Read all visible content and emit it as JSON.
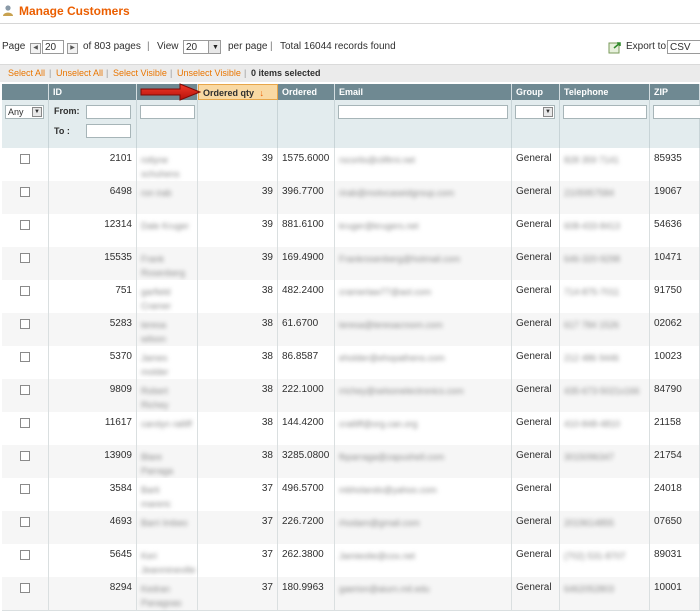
{
  "page": {
    "title": "Manage Customers",
    "accent_color": "#eb5e00"
  },
  "pager": {
    "page_label": "Page",
    "page_value": "20",
    "of_pages": "of 803 pages",
    "sep1": "|",
    "view_label": "View",
    "view_value": "20",
    "per_page": "per page",
    "sep2": "|",
    "total": "Total 16044 records found",
    "export_label": "Export to:",
    "export_value": "CSV"
  },
  "massaction": {
    "select_all": "Select All",
    "unselect_all": "Unselect All",
    "select_visible": "Select Visible",
    "unselect_visible": "Unselect Visible",
    "selected": "0 items selected",
    "sep": "|"
  },
  "columns": {
    "id": "ID",
    "name": "",
    "ordered_qty": "Ordered qty",
    "ordered": "Ordered",
    "email": "Email",
    "group": "Group",
    "telephone": "Telephone",
    "zip": "ZIP"
  },
  "filters": {
    "any": "Any",
    "from": "From:",
    "to": "To :"
  },
  "rows": [
    {
      "id": "2101",
      "name1": "rotlyne",
      "name2": "schuhens",
      "qty": "39",
      "ordered": "1575.6000",
      "email": "rscorlis@cliftrni.net",
      "group": "General",
      "tel": "828 359 7141",
      "zip": "85935"
    },
    {
      "id": "6498",
      "name1": "ron irab",
      "name2": "",
      "qty": "39",
      "ordered": "396.7700",
      "email": "rirab@motvcaseidgroup.com",
      "group": "General",
      "tel": "2105957584",
      "zip": "19067"
    },
    {
      "id": "12314",
      "name1": "Dale Kruger",
      "name2": "",
      "qty": "39",
      "ordered": "881.6100",
      "email": "kruger@krugers.net",
      "group": "General",
      "tel": "608-433-8413",
      "zip": "54636"
    },
    {
      "id": "15535",
      "name1": "Frank",
      "name2": "Rosenberg",
      "qty": "39",
      "ordered": "169.4900",
      "email": "Frankrosenberg@hotmail.com",
      "group": "General",
      "tel": "646-320-9298",
      "zip": "10471"
    },
    {
      "id": "751",
      "name1": "garfield",
      "name2": "Cramer",
      "qty": "38",
      "ordered": "482.2400",
      "email": "cramerlaw77@aol.com",
      "group": "General",
      "tel": "714-875-7011",
      "zip": "91750"
    },
    {
      "id": "5283",
      "name1": "teresa",
      "name2": "wilson",
      "qty": "38",
      "ordered": "61.6700",
      "email": "teresa@teresacroom.com",
      "group": "General",
      "tel": "617 784 1526",
      "zip": "02062"
    },
    {
      "id": "5370",
      "name1": "James",
      "name2": "molder",
      "qty": "38",
      "ordered": "86.8587",
      "email": "eholder@ehopathens.com",
      "group": "General",
      "tel": "212 486 9446",
      "zip": "10023"
    },
    {
      "id": "9809",
      "name1": "Robert",
      "name2": "Richey",
      "qty": "38",
      "ordered": "222.1000",
      "email": "rrichey@selsonelectronics.com",
      "group": "General",
      "tel": "435-673-5021x166",
      "zip": "84790"
    },
    {
      "id": "11617",
      "name1": "carolyn ratliff",
      "name2": "",
      "qty": "38",
      "ordered": "144.4200",
      "email": "cratliff@org.can.org",
      "group": "General",
      "tel": "410-848-4810",
      "zip": "21158"
    },
    {
      "id": "13909",
      "name1": "Blare",
      "name2": "Parraga",
      "qty": "38",
      "ordered": "3285.0800",
      "email": "fbparraga@zapushell.com",
      "group": "General",
      "tel": "3015096347",
      "zip": "21754"
    },
    {
      "id": "3584",
      "name1": "Barti",
      "name2": "mareric",
      "qty": "37",
      "ordered": "496.5700",
      "email": "mbholando@yahoo.com",
      "group": "General",
      "tel": "",
      "zip": "24018"
    },
    {
      "id": "4693",
      "name1": "Barri Imbeo",
      "name2": "",
      "qty": "37",
      "ordered": "226.7200",
      "email": "rhodam@gmail.com",
      "group": "General",
      "tel": "2019614855",
      "zip": "07650"
    },
    {
      "id": "5645",
      "name1": "Keri",
      "name2": "Jeanmineville",
      "qty": "37",
      "ordered": "262.3800",
      "email": "Jamieolie@cox.net",
      "group": "General",
      "tel": "(702) 531-8707",
      "zip": "89031"
    },
    {
      "id": "8294",
      "name1": "Kedran",
      "name2": "Panagoas",
      "qty": "37",
      "ordered": "180.9963",
      "email": "gaerion@aiurn.mil.edu",
      "group": "General",
      "tel": "6462052803",
      "zip": "10001"
    }
  ]
}
